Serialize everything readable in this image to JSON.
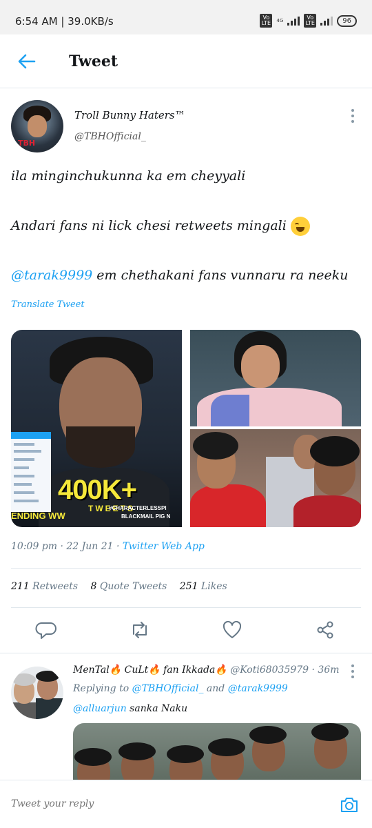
{
  "status_bar": {
    "time_speed": "6:54 AM | 39.0KB/s",
    "volte_label": "Vo LTE",
    "network_tag": "4G",
    "battery": "96"
  },
  "header": {
    "title": "Tweet",
    "back_icon": "arrow-left-icon"
  },
  "tweet": {
    "author_name": "Troll Bunny Haters™",
    "author_handle": "@TBHOfficial_",
    "avatar_logo": "TBH",
    "line1": "ila minginchukunna ka em cheyyali",
    "line2": "Andari fans ni lick chesi retweets mingali",
    "line3_mention": "@tarak9999",
    "line3_rest": " em chethakani fans vunnaru ra neeku",
    "translate": "Translate Tweet",
    "media_left": {
      "count_text": "400K+",
      "tweets_word": "TWEETS",
      "trend_text": "ENDING WW",
      "hashtag_1": "#CHARACTERLESSPI",
      "hashtag_2": "BLACKMAIL PIG N"
    },
    "timestamp": "10:09 pm · 22 Jun 21 · ",
    "source": "Twitter Web App",
    "stats": {
      "retweets_count": "211",
      "retweets_label": " Retweets",
      "quotes_count": "8",
      "quotes_label": " Quote Tweets",
      "likes_count": "251",
      "likes_label": " Likes"
    },
    "actions": [
      "reply-icon",
      "retweet-icon",
      "like-icon",
      "share-icon"
    ]
  },
  "reply": {
    "name_part1": "MenTal",
    "name_part2": " CuLt",
    "name_part3": " fan Ikkada",
    "fire": "🔥",
    "handle_time": " @Koti68035979 · 36m",
    "replying_prefix": "Replying to ",
    "replying_user1": "@TBHOfficial_",
    "replying_and": " and ",
    "replying_user2": "@tarak9999",
    "text_mention": "@alluarjun",
    "text_rest": " sanka Naku"
  },
  "composer": {
    "placeholder": "Tweet your reply",
    "camera_icon": "camera-icon"
  },
  "colors": {
    "accent": "#1da1f2",
    "muted": "#657786",
    "divider": "#e1e8ed"
  }
}
